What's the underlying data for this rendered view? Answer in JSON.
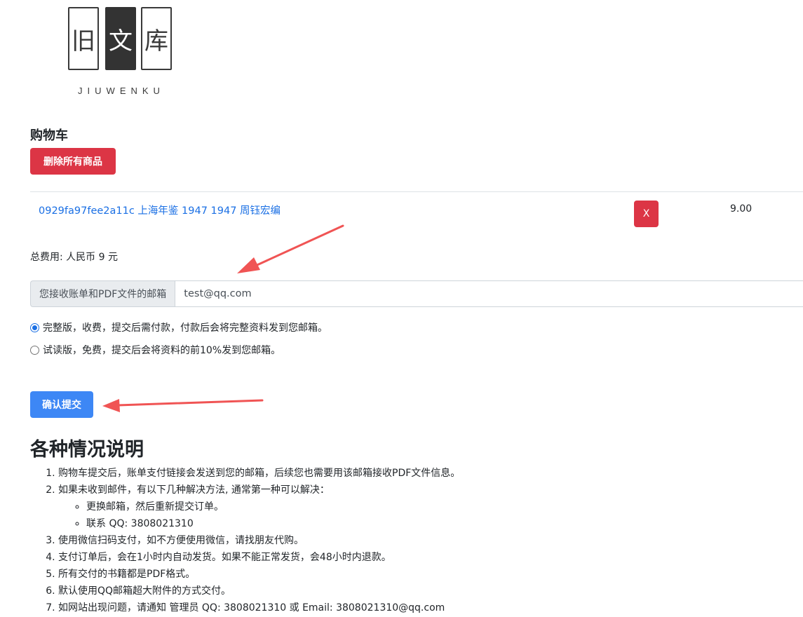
{
  "logo": {
    "chars": [
      "旧",
      "文",
      "库"
    ],
    "latin": "JIUWENKU"
  },
  "cart": {
    "title": "购物车",
    "delete_all_label": "删除所有商品",
    "items": [
      {
        "title": "0929fa97fee2a11c 上海年鉴 1947 1947 周钰宏编",
        "remove_label": "X",
        "price": "9.00"
      }
    ],
    "total_label": "总费用: 人民币 9 元"
  },
  "email": {
    "label": "您接收账单和PDF文件的邮箱",
    "value": "test@qq.com"
  },
  "options": [
    {
      "label": "完整版，收费，提交后需付款，付款后会将完整资料发到您邮箱。",
      "checked": true
    },
    {
      "label": "试读版，免费，提交后会将资料的前10%发到您邮箱。",
      "checked": false
    }
  ],
  "submit_label": "确认提交",
  "info": {
    "title": "各种情况说明",
    "items": [
      "购物车提交后，账单支付链接会发送到您的邮箱，后续您也需要用该邮箱接收PDF文件信息。",
      "如果未收到邮件，有以下几种解决方法, 通常第一种可以解决：",
      "使用微信扫码支付，如不方便使用微信，请找朋友代购。",
      "支付订单后，会在1小时内自动发货。如果不能正常发货，会48小时内退款。",
      "所有交付的书籍都是PDF格式。",
      "默认使用QQ邮箱超大附件的方式交付。",
      "如网站出现问题，请通知 管理员 QQ: 3808021310 或 Email: 3808021310@qq.com"
    ],
    "subitems": [
      "更换邮箱，然后重新提交订单。",
      "联系 QQ: 3808021310"
    ]
  },
  "colors": {
    "danger": "#dc3545",
    "primary": "#3d87f5",
    "link": "#1a6fe4",
    "annotation_arrow": "#f05454"
  }
}
